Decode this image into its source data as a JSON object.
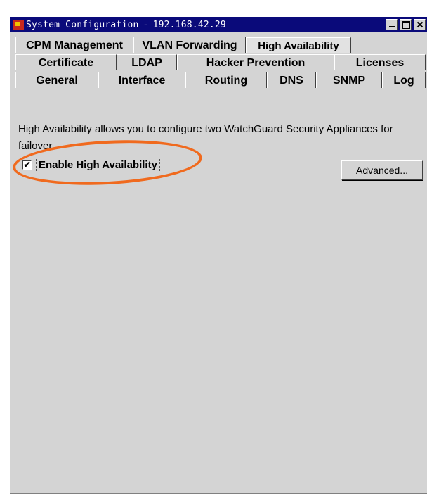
{
  "window": {
    "title": "System Configuration",
    "title_separator": "-",
    "ip_address": "192.168.42.29",
    "app_icon": "watchguard-logo-icon",
    "controls": [
      "minimize-icon",
      "maximize-icon",
      "close-icon"
    ]
  },
  "tabs": {
    "row1": [
      {
        "label": "CPM Management"
      },
      {
        "label": "VLAN Forwarding"
      },
      {
        "label": "High Availability",
        "active": true
      }
    ],
    "row2": [
      {
        "label": "Certificate"
      },
      {
        "label": "LDAP"
      },
      {
        "label": "Hacker Prevention"
      },
      {
        "label": "Licenses"
      }
    ],
    "row3": [
      {
        "label": "General"
      },
      {
        "label": "Interface"
      },
      {
        "label": "Routing"
      },
      {
        "label": "DNS"
      },
      {
        "label": "SNMP"
      },
      {
        "label": "Log"
      }
    ]
  },
  "high_availability": {
    "description": "High Availability allows you to configure two WatchGuard Security Appliances for failover.",
    "enable_label": "Enable High Availability",
    "enable_checked": true,
    "check_mark": "✔",
    "advanced_button_label": "Advanced..."
  },
  "colors": {
    "titlebar": "#0a0a7a",
    "window_bg": "#d4d4d4",
    "highlight_annotation": "#f06a1e"
  }
}
